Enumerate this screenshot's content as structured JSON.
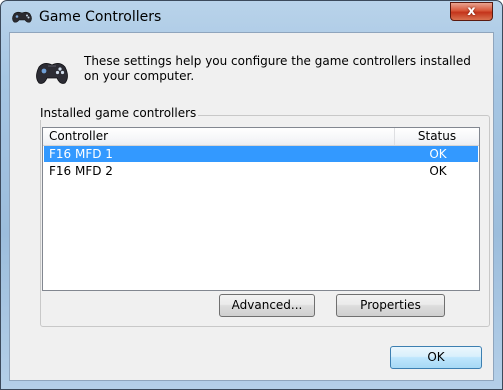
{
  "window": {
    "title": "Game Controllers",
    "close_label": "x"
  },
  "header": {
    "description": "These settings help you configure the game controllers installed on your computer."
  },
  "controllers": {
    "group_label": "Installed game controllers",
    "columns": {
      "controller": "Controller",
      "status": "Status"
    },
    "rows": [
      {
        "name": "F16 MFD 1",
        "status": "OK",
        "selected": true
      },
      {
        "name": "F16 MFD 2",
        "status": "OK",
        "selected": false
      }
    ]
  },
  "buttons": {
    "advanced": "Advanced...",
    "properties": "Properties",
    "ok": "OK"
  },
  "colors": {
    "selection": "#3399ff",
    "close_button": "#c4341b"
  },
  "icons": {
    "title": "gamepad-icon",
    "header": "gamepad-icon",
    "close": "close-icon"
  }
}
